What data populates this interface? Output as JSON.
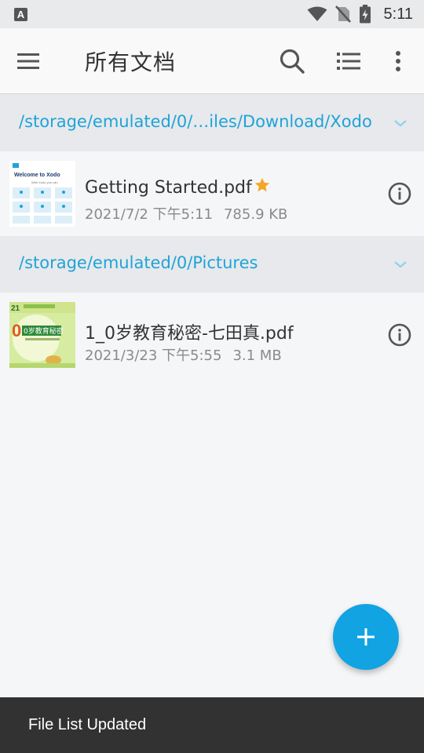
{
  "status_bar": {
    "notification_glyph": "A",
    "time": "5:11",
    "icons": [
      "wifi-icon",
      "no-sim-icon",
      "battery-charging-icon"
    ]
  },
  "app_bar": {
    "title": "所有文档",
    "icons": [
      "menu-icon",
      "search-icon",
      "list-view-icon",
      "more-vert-icon"
    ]
  },
  "sections": [
    {
      "path": "/storage/emulated/0/…iles/Download/Xodo",
      "files": [
        {
          "name": "Getting Started.pdf",
          "starred": true,
          "date": "2021/7/2 下午5:11",
          "size": "785.9 KB",
          "thumb_title": "Welcome to Xodo",
          "thumb_subtitle": "With Xodo you can"
        }
      ]
    },
    {
      "path": "/storage/emulated/0/Pictures",
      "files": [
        {
          "name": "1_0岁教育秘密-七田真.pdf",
          "starred": false,
          "date": "2021/3/23 下午5:55",
          "size": "3.1 MB",
          "thumb_title": "0岁教育秘密"
        }
      ]
    }
  ],
  "fab": {
    "icon": "plus-icon"
  },
  "snackbar": {
    "message": "File List Updated"
  },
  "colors": {
    "accent": "#1fa3d8",
    "fab": "#11a3e2",
    "star": "#f5a623",
    "snackbar_bg": "#323232"
  }
}
